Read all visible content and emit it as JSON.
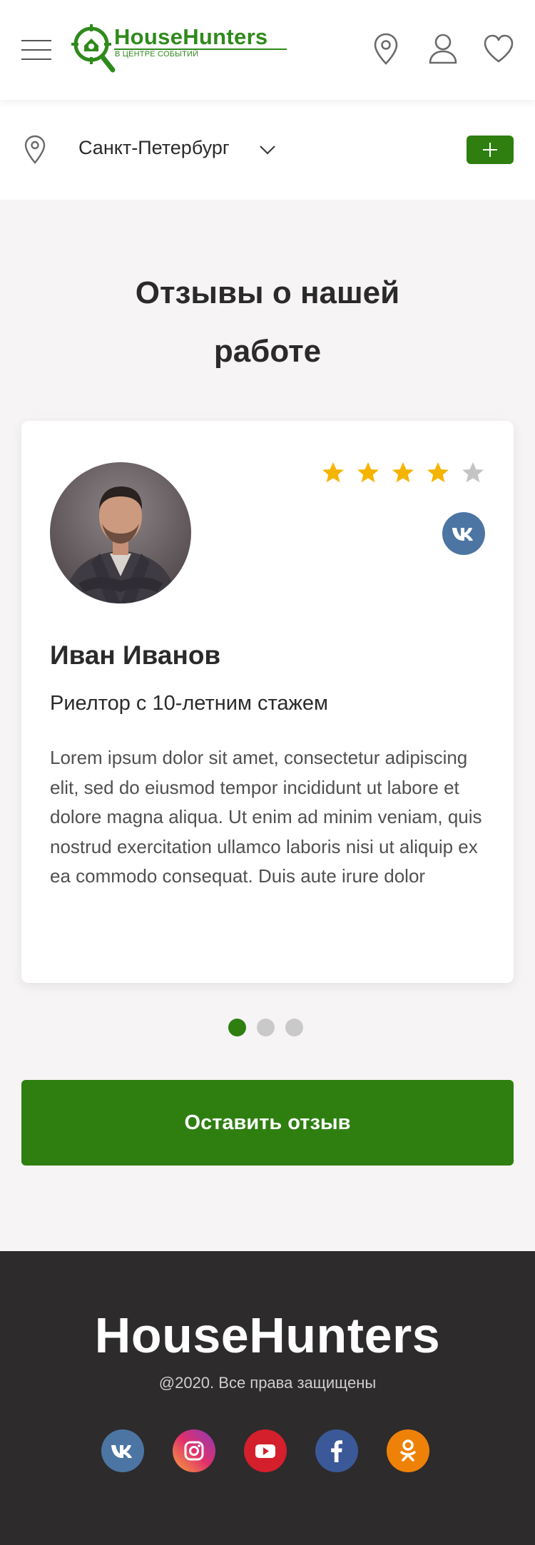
{
  "header": {
    "logo_title": "HouseHunters",
    "logo_subtitle": "В ЦЕНТРЕ СОБЫТИЙ",
    "icons": [
      "menu-icon",
      "location-pin-icon",
      "user-icon",
      "heart-icon"
    ]
  },
  "city_bar": {
    "city": "Санкт-Петербург",
    "add_button_icon": "plus-icon"
  },
  "reviews": {
    "title": "Отзывы о нашей работе",
    "current": {
      "name": "Иван Иванов",
      "role": "Риелтор с 10-летним стажем",
      "rating": 4,
      "max_rating": 5,
      "social": "vk-icon",
      "text": "Lorem ipsum dolor sit amet, consectetur adipiscing elit, sed do eiusmod tempor incididunt ut labore et dolore magna aliqua. Ut enim ad minim veniam, quis nostrud exercitation ullamco laboris nisi ut aliquip ex ea commodo consequat. Duis aute irure dolor"
    },
    "pagination": {
      "total": 3,
      "active": 1
    },
    "leave_button": "Оставить отзыв"
  },
  "footer": {
    "brand": "HouseHunters",
    "copyright": "@2020. Все права защищены",
    "socials": [
      "vk-icon",
      "instagram-icon",
      "youtube-icon",
      "facebook-icon",
      "odnoklassniki-icon"
    ]
  },
  "colors": {
    "brand_green": "#2e7f10",
    "star": "#f5b400",
    "footer_bg": "#2d2b2c",
    "vk": "#4c75a3",
    "youtube": "#d41f2c",
    "facebook": "#3b5998",
    "odnoklassniki": "#ee8208"
  }
}
